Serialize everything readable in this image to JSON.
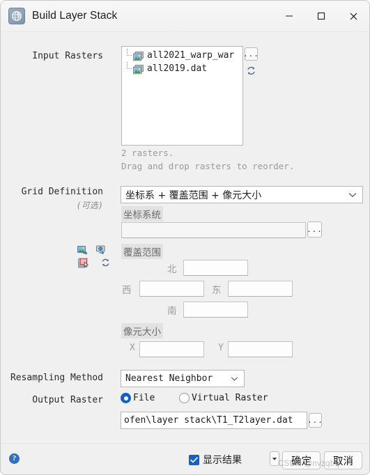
{
  "window": {
    "title": "Build Layer Stack",
    "app_icon": "envi-globe-icon",
    "minimize": "minimize-icon",
    "maximize": "maximize-icon",
    "close": "close-icon"
  },
  "input_rasters": {
    "label": "Input Rasters",
    "items": [
      {
        "name": "all2021_warp_war",
        "icon": "raster-layer-icon"
      },
      {
        "name": "all2019.dat",
        "icon": "raster-layer-icon"
      }
    ],
    "browse_button": "...",
    "refresh_button": "refresh-icon",
    "count_text": "2 rasters.",
    "reorder_hint": "Drag and drop rasters to reorder."
  },
  "grid_definition": {
    "label": "Grid Definition",
    "optional": "(可选)",
    "method_value": "坐标系 + 覆盖范围 + 像元大小",
    "tool_icons": [
      "image-layer-icon",
      "screen-extent-icon",
      "calculator-icon",
      "selection-box-icon",
      "refresh-icon"
    ],
    "coordinate_system": {
      "label": "坐标系统",
      "value": "",
      "browse_button": "..."
    },
    "extent": {
      "label": "覆盖范围",
      "north_label": "北",
      "north_value": "",
      "west_label": "西",
      "west_value": "",
      "east_label": "东",
      "east_value": "",
      "south_label": "南",
      "south_value": ""
    },
    "pixel_size": {
      "label": "像元大小",
      "x_label": "X",
      "x_value": "",
      "y_label": "Y",
      "y_value": ""
    }
  },
  "resampling": {
    "label": "Resampling Method",
    "value": "Nearest Neighbor"
  },
  "output": {
    "label": "Output Raster",
    "file_option": "File",
    "virtual_option": "Virtual Raster",
    "selected": "File",
    "path_value": "ofen\\layer stack\\T1_T2layer.dat",
    "browse_button": "..."
  },
  "footer": {
    "help": "?",
    "display_result_label": "显示结果",
    "display_result_checked": true,
    "split_arrow": "chevron-down-icon",
    "ok_label": "确定",
    "cancel_label": "取消"
  },
  "watermark": "CSDN @nvzqbq",
  "colors": {
    "accent": "#1262c4",
    "dialog_bg": "#f0f0f0",
    "field_bg": "#ffffff",
    "hint_text": "#9a9a9a",
    "section_label_bg": "#e2e2e2"
  }
}
